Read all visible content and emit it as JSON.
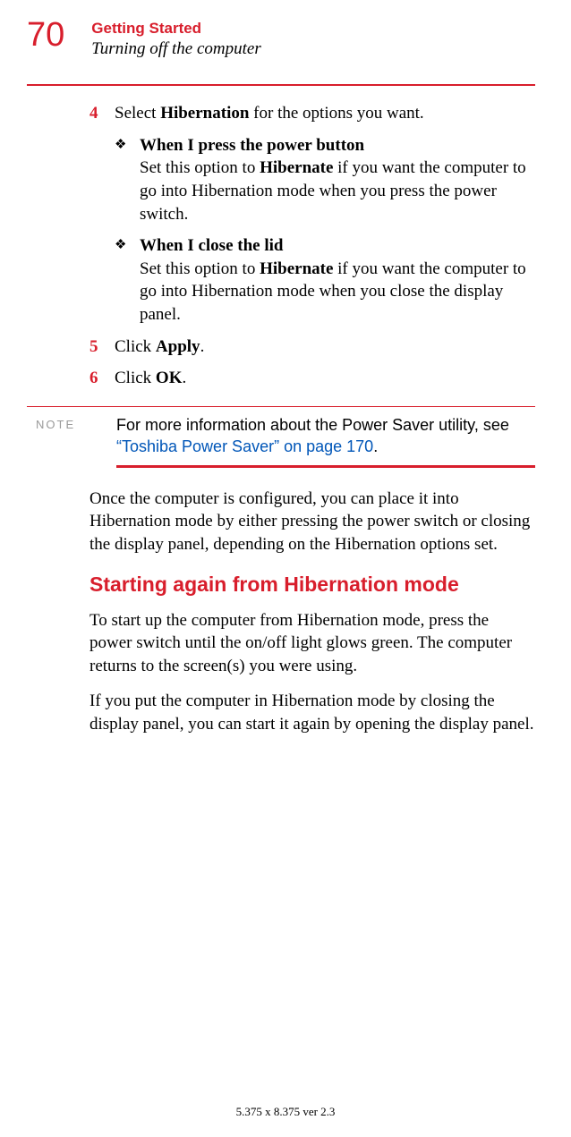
{
  "page_number": "70",
  "chapter": "Getting Started",
  "section": "Turning off the computer",
  "steps": {
    "s4": {
      "num": "4",
      "text_pre": "Select ",
      "bold": "Hibernation",
      "text_post": " for the options you want."
    },
    "s5": {
      "num": "5",
      "text_pre": "Click ",
      "bold": "Apply",
      "text_post": "."
    },
    "s6": {
      "num": "6",
      "text_pre": "Click ",
      "bold": "OK",
      "text_post": "."
    }
  },
  "bullets": {
    "b1": {
      "title": "When I press the power button",
      "line1_pre": "Set this option to ",
      "line1_bold": "Hibernate",
      "line1_post": " if you want the computer to go into Hibernation mode when you press the power switch."
    },
    "b2": {
      "title": "When I close the lid",
      "line1_pre": "Set this option to ",
      "line1_bold": "Hibernate",
      "line1_post": " if you want the computer to go into Hibernation mode when you close the display panel."
    }
  },
  "note": {
    "label": "NOTE",
    "text": "For more information about the Power Saver utility, see ",
    "link": "“Toshiba Power Saver” on page 170",
    "tail": "."
  },
  "para1": "Once the computer is configured, you can place it into Hibernation mode by either pressing the power switch or closing the display panel, depending on the Hibernation options set.",
  "subheading": "Starting again from Hibernation mode",
  "para2": "To start up the computer from Hibernation mode, press the power switch until the on/off light glows green. The computer returns to the screen(s) you were using.",
  "para3": "If you put the computer in Hibernation mode by closing the display panel, you can start it again by opening the display panel.",
  "footer": "5.375 x 8.375 ver 2.3",
  "bullet_glyph": "❖"
}
